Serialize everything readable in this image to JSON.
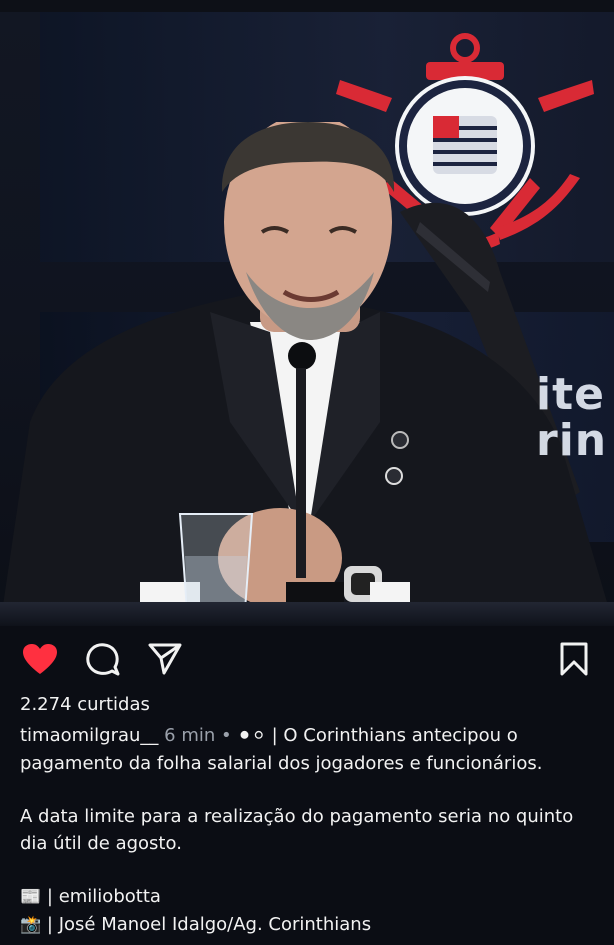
{
  "post": {
    "likes_text": "2.274 curtidas",
    "username": "timaomilgrau__",
    "time": "6 min",
    "separator": "•",
    "badge_glyphs": "⚫⚪",
    "caption_line1": "| O Corinthians antecipou o pagamento da folha salarial dos jogadores e funcionários.",
    "caption_line2": "A data limite para a realização do pagamento seria no quinto dia útil de agosto.",
    "credit1_emoji": "📰",
    "credit1_text": "| emiliobotta",
    "credit2_emoji": "📸",
    "credit2_text": "| José Manoel Idalgo/Ag. Corinthians"
  },
  "photo": {
    "backdrop_text": "ite\nrin"
  },
  "icons": {
    "like": "heart-icon",
    "comment": "comment-icon",
    "share": "share-icon",
    "save": "bookmark-icon"
  },
  "colors": {
    "background": "#0b0d14",
    "like_red": "#ff3040",
    "text": "#f2f2f2",
    "muted": "#9aa0aa"
  }
}
